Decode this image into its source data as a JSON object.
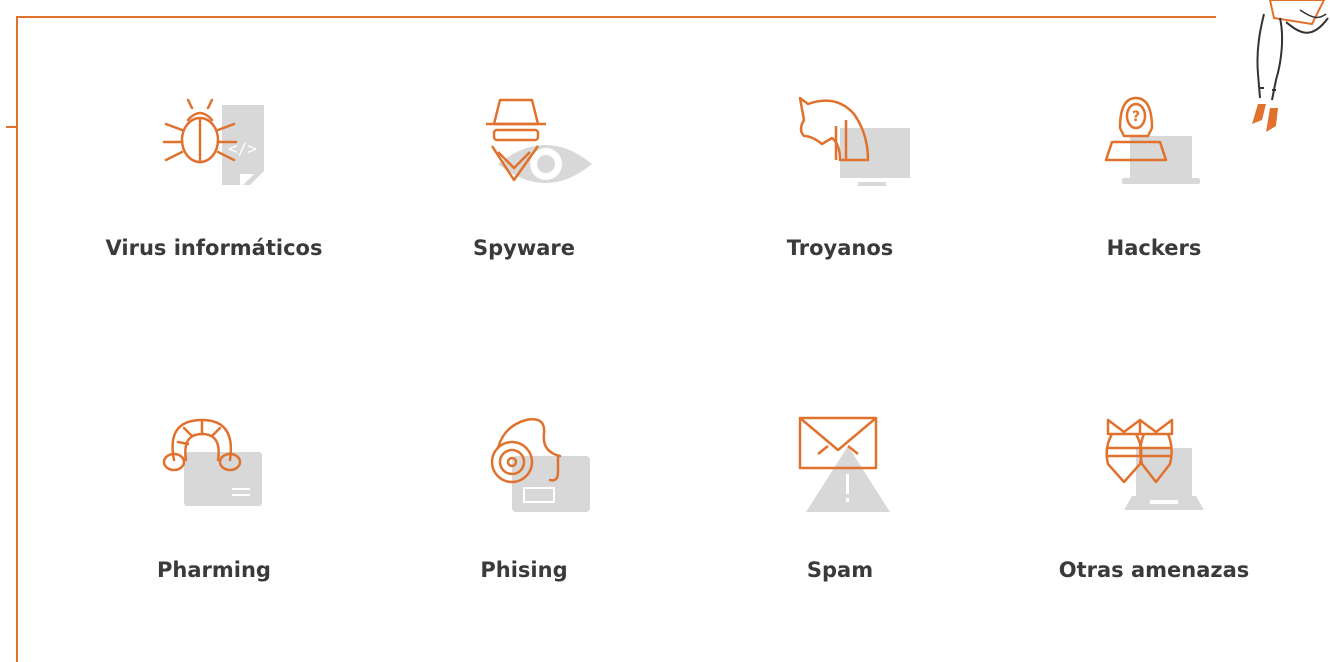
{
  "accent_color": "#E0722E",
  "secondary_color": "#D8D8D8",
  "threats": [
    {
      "label": "Virus informáticos",
      "icon": "bug-document-icon"
    },
    {
      "label": "Spyware",
      "icon": "spy-eye-icon"
    },
    {
      "label": "Troyanos",
      "icon": "trojan-horse-monitor-icon"
    },
    {
      "label": "Hackers",
      "icon": "hooded-hacker-laptop-icon"
    },
    {
      "label": "Pharming",
      "icon": "worm-card-icon"
    },
    {
      "label": "Phising",
      "icon": "fishing-hook-card-icon"
    },
    {
      "label": "Spam",
      "icon": "envelope-warning-icon"
    },
    {
      "label": "Otras amenazas",
      "icon": "bombs-laptop-icon"
    }
  ]
}
